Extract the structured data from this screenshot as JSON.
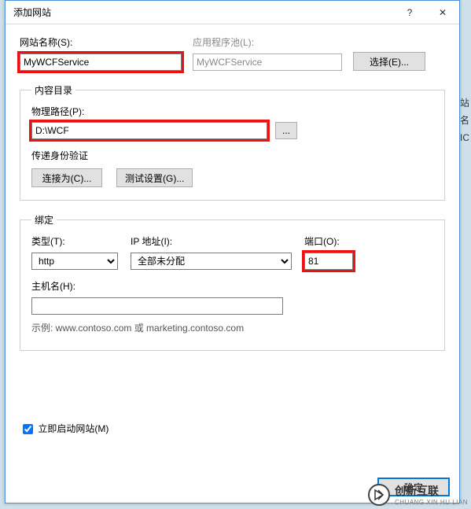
{
  "backdrop": {
    "hint1": "站",
    "hint2": "名",
    "hint3": "IC"
  },
  "dialog": {
    "title": "添加网站",
    "help": "?",
    "close": "✕"
  },
  "site": {
    "name_label": "网站名称(S):",
    "name_value": "MyWCFService",
    "pool_label": "应用程序池(L):",
    "pool_value": "MyWCFService",
    "select_button": "选择(E)..."
  },
  "content_dir": {
    "legend": "内容目录",
    "path_label": "物理路径(P):",
    "path_value": "D:\\WCF",
    "browse": "...",
    "auth_label": "传递身份验证",
    "connect_as": "连接为(C)...",
    "test_settings": "测试设置(G)..."
  },
  "binding": {
    "legend": "绑定",
    "type_label": "类型(T):",
    "type_value": "http",
    "ip_label": "IP 地址(I):",
    "ip_value": "全部未分配",
    "port_label": "端口(O):",
    "port_value": "81",
    "host_label": "主机名(H):",
    "host_value": "",
    "example": "示例: www.contoso.com 或 marketing.contoso.com"
  },
  "start": {
    "label": "立即启动网站(M)",
    "checked": true
  },
  "buttons": {
    "ok": "确定",
    "cancel_hidden": ""
  },
  "watermark": {
    "brand": "创新互联",
    "sub": "CHUANG XIN HU LIAN"
  }
}
